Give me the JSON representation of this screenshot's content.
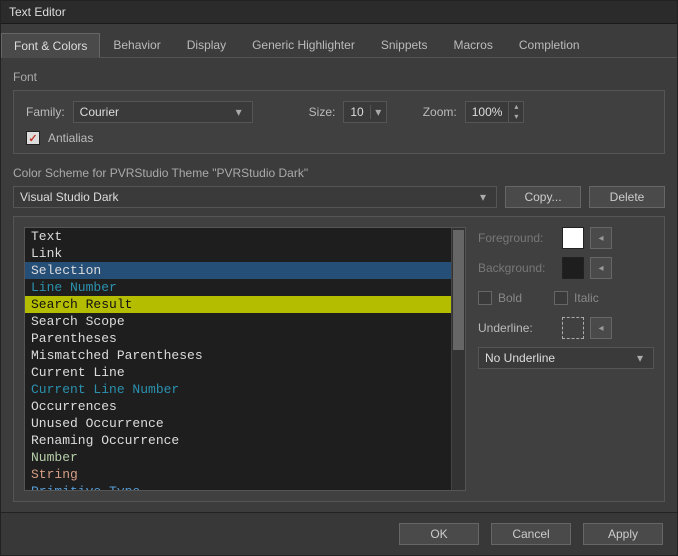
{
  "window": {
    "title": "Text Editor"
  },
  "tabs": {
    "items": [
      "Font & Colors",
      "Behavior",
      "Display",
      "Generic Highlighter",
      "Snippets",
      "Macros",
      "Completion"
    ],
    "active_index": 0
  },
  "font": {
    "section_label": "Font",
    "family_label": "Family:",
    "family_value": "Courier",
    "size_label": "Size:",
    "size_value": "10",
    "zoom_label": "Zoom:",
    "zoom_value": "100%",
    "antialias_checked": true,
    "antialias_label": "Antialias"
  },
  "scheme": {
    "label": "Color Scheme for PVRStudio Theme \"PVRStudio Dark\"",
    "value": "Visual Studio Dark",
    "copy_label": "Copy...",
    "delete_label": "Delete"
  },
  "list_items": [
    {
      "text": "Text",
      "fg": "#dcdcdc",
      "bg": "#1e1e1e"
    },
    {
      "text": "Link",
      "fg": "#dcdcdc",
      "bg": "#1e1e1e"
    },
    {
      "text": "Selection",
      "fg": "#dcdcdc",
      "bg": "#264f78"
    },
    {
      "text": "Line Number",
      "fg": "#2b91af",
      "bg": "#1e1e1e"
    },
    {
      "text": "Search Result",
      "fg": "#111111",
      "bg": "#b5bd00"
    },
    {
      "text": "Search Scope",
      "fg": "#dcdcdc",
      "bg": "#1e1e1e"
    },
    {
      "text": "Parentheses",
      "fg": "#dcdcdc",
      "bg": "#1e1e1e"
    },
    {
      "text": "Mismatched Parentheses",
      "fg": "#dcdcdc",
      "bg": "#1e1e1e"
    },
    {
      "text": "Current Line",
      "fg": "#dcdcdc",
      "bg": "#1e1e1e"
    },
    {
      "text": "Current Line Number",
      "fg": "#2b91af",
      "bg": "#1e1e1e"
    },
    {
      "text": "Occurrences",
      "fg": "#dcdcdc",
      "bg": "#1e1e1e"
    },
    {
      "text": "Unused Occurrence",
      "fg": "#dcdcdc",
      "bg": "#1e1e1e"
    },
    {
      "text": "Renaming Occurrence",
      "fg": "#dcdcdc",
      "bg": "#1e1e1e"
    },
    {
      "text": "Number",
      "fg": "#b5cea8",
      "bg": "#1e1e1e"
    },
    {
      "text": "String",
      "fg": "#d69d85",
      "bg": "#1e1e1e"
    },
    {
      "text": "Primitive Type",
      "fg": "#569cd6",
      "bg": "#1e1e1e"
    }
  ],
  "side": {
    "foreground_label": "Foreground:",
    "foreground_color": "#ffffff",
    "background_label": "Background:",
    "background_color": "#1e1e1e",
    "bold_label": "Bold",
    "italic_label": "Italic",
    "underline_label": "Underline:",
    "underline_combo_value": "No Underline"
  },
  "footer": {
    "ok": "OK",
    "cancel": "Cancel",
    "apply": "Apply"
  }
}
